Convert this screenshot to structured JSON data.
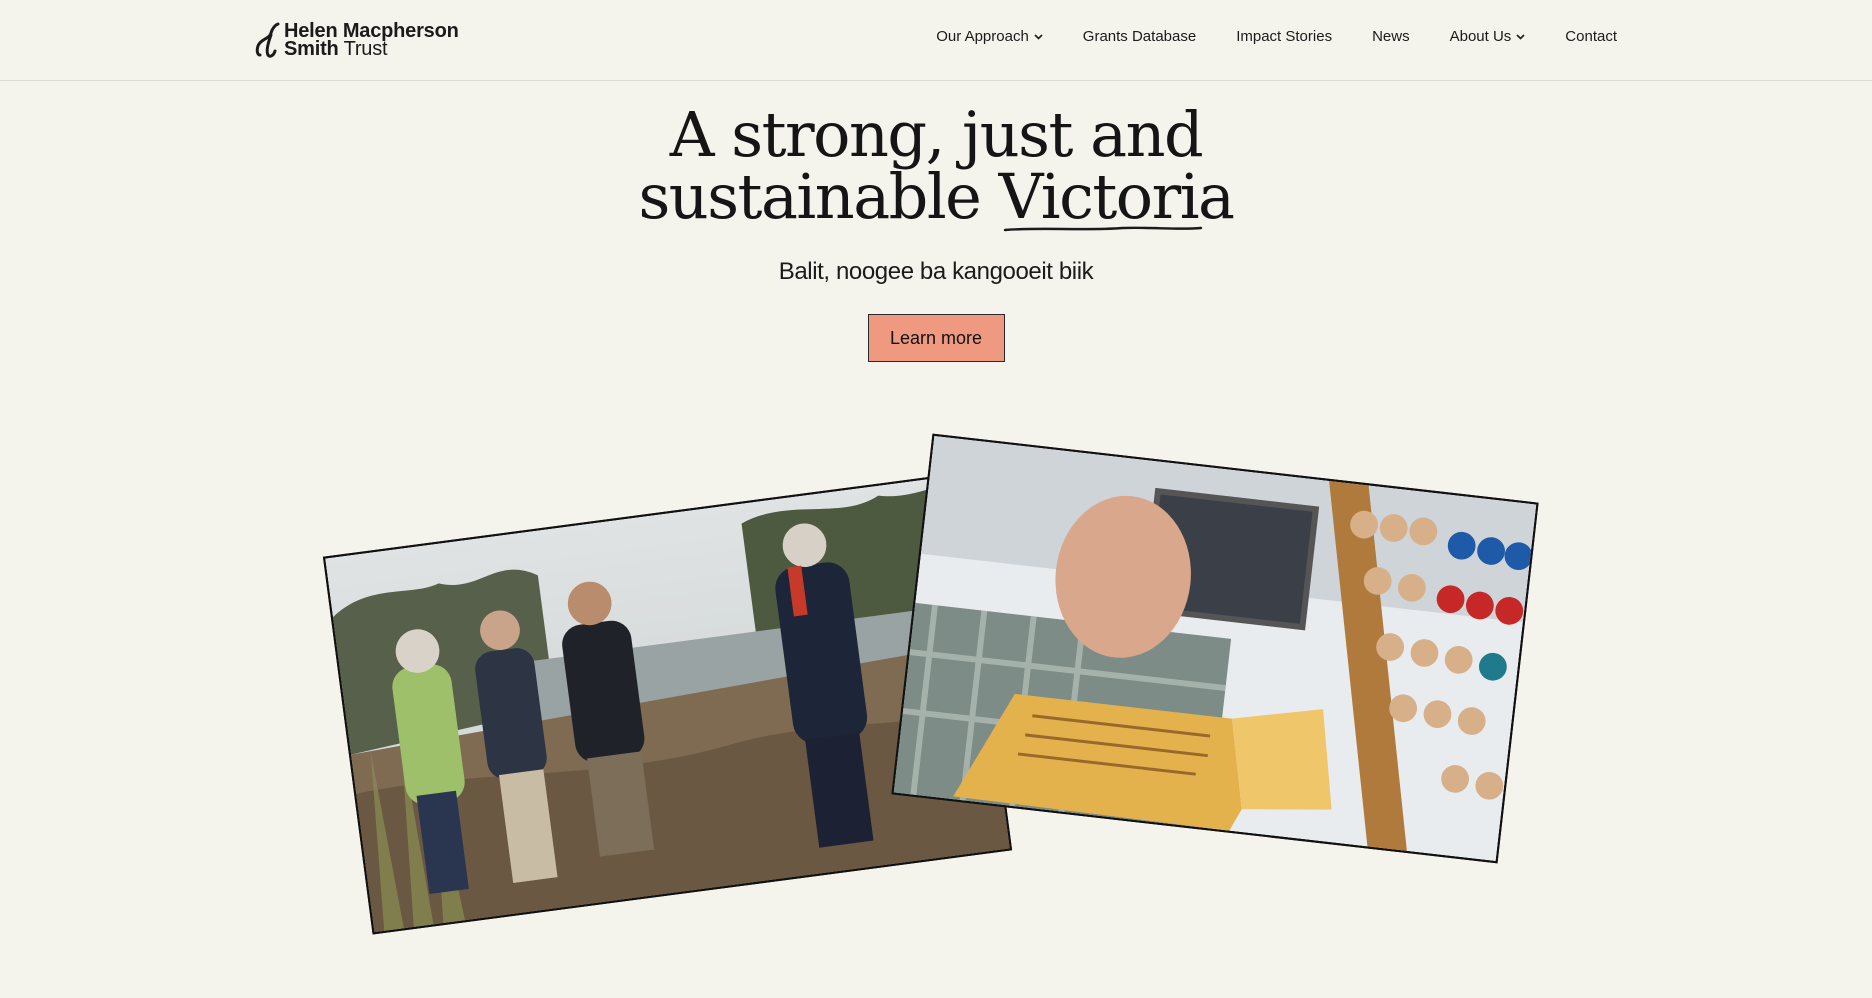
{
  "header": {
    "logo": {
      "line1": "Helen Macpherson",
      "line2_bold": "Smith",
      "line2_regular": "Trust",
      "icon": "hmst-logo-mark"
    },
    "nav": [
      {
        "label": "Our Approach",
        "has_dropdown": true
      },
      {
        "label": "Grants Database",
        "has_dropdown": false
      },
      {
        "label": "Impact Stories",
        "has_dropdown": false
      },
      {
        "label": "News",
        "has_dropdown": false
      },
      {
        "label": "About Us",
        "has_dropdown": true
      },
      {
        "label": "Contact",
        "has_dropdown": false
      }
    ]
  },
  "hero": {
    "headline_line1": "A strong, just and",
    "headline_line2_pre": "sustainable",
    "headline_line2_emph": "Victoria",
    "subheading": "Balit, noogee ba kangooeit biik",
    "cta_label": "Learn more"
  },
  "colors": {
    "background": "#f4f3ec",
    "cta": "#ef9a80",
    "text": "#1b1b1b"
  },
  "images": [
    {
      "name": "river-group-photo"
    },
    {
      "name": "man-reading-book-abacus-photo"
    }
  ]
}
